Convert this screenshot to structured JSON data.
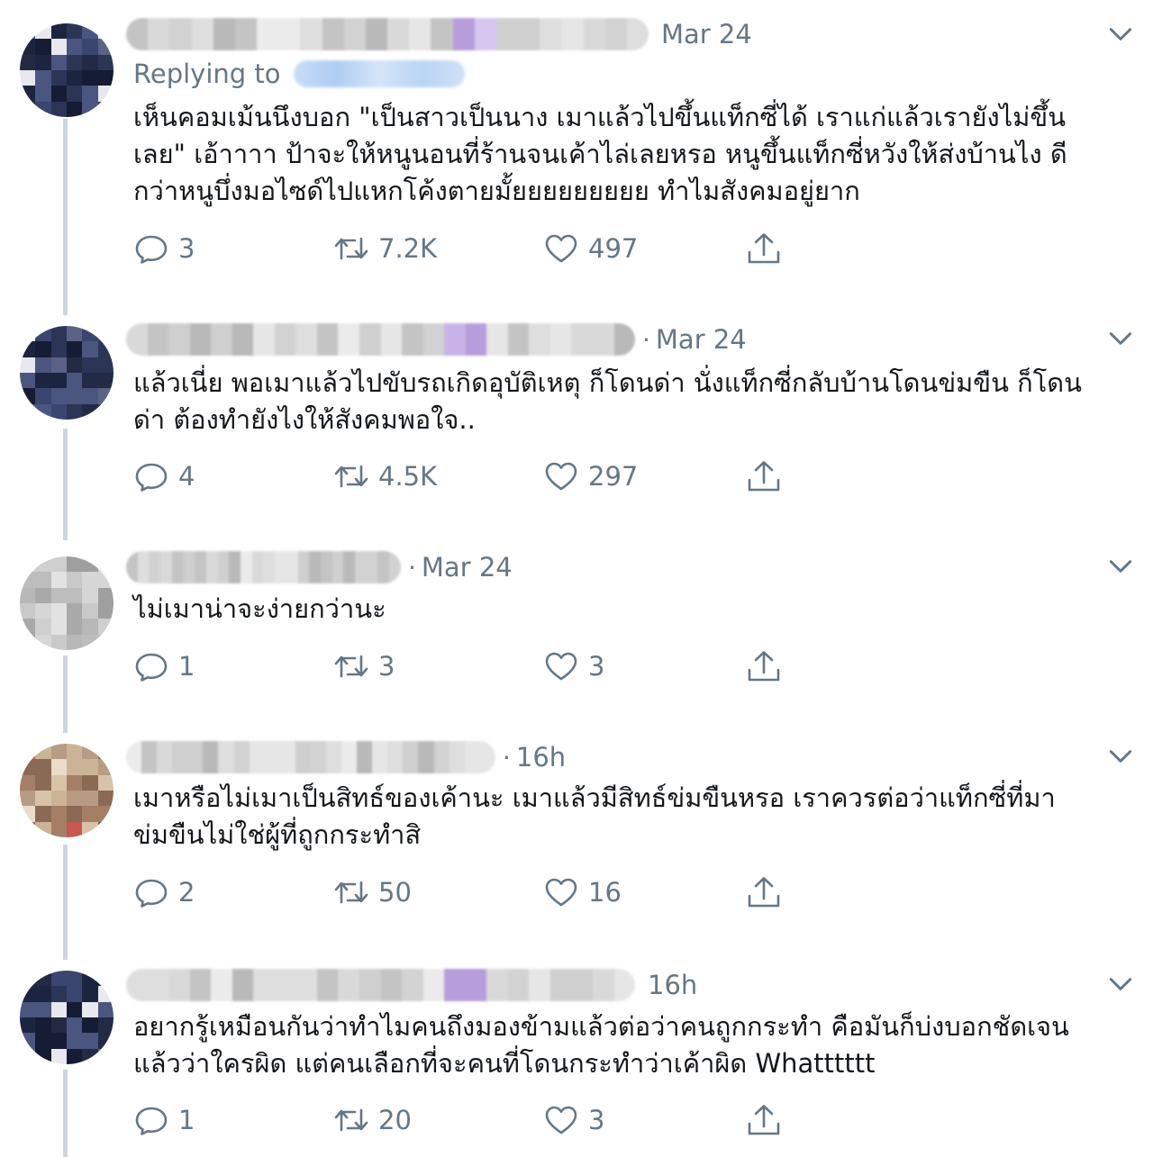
{
  "tweets": [
    {
      "date": "Mar 24",
      "date_prefix": "",
      "replying_label": "Replying to",
      "text_lines": [
        "เห็นคอมเม้นนึงบอก \"เป็นสาวเป็นนาง เมาแล้วไปขึ้นแท็กซี่ได้ เราแก่แล้วเรายังไม่ขึ้น",
        "เลย\" เอ้าาาา ป้าจะให้หนูนอนที่ร้านจนเค้าไล่เลยหรอ หนูขึ้นแท็กซี่หวังให้ส่งบ้านไง ดี",
        "กว่าหนูบึ่งมอไซด์ไปแหกโค้งตายมั้ยยยยยยยยย ทำไมสังคมอยู่ยาก"
      ],
      "replies": "3",
      "retweets": "7.2K",
      "likes": "497"
    },
    {
      "date": "Mar 24",
      "date_prefix": "·",
      "text_lines": [
        "แล้วเนี่ย พอเมาแล้วไปขับรถเกิดอุบัติเหตุ ก็โดนด่า นั่งแท็กซี่กลับบ้านโดนข่มขืน ก็โดน",
        "ด่า ต้องทำยังไงให้สังคมพอใจ.."
      ],
      "replies": "4",
      "retweets": "4.5K",
      "likes": "297"
    },
    {
      "date": "Mar 24",
      "date_prefix": "·",
      "text_lines": [
        "ไม่เมาน่าจะง่ายกว่านะ"
      ],
      "replies": "1",
      "retweets": "3",
      "likes": "3"
    },
    {
      "date": "16h",
      "date_prefix": "·",
      "text_lines": [
        "เมาหรือไม่เมาเป็นสิทธ์ของเค้านะ เมาแล้วมีสิทธ์ข่มขืนหรอ เราควรต่อว่าแท็กซี่ที่มา",
        "ข่มขืนไม่ใช่ผู้ที่ถูกกระทำสิ"
      ],
      "replies": "2",
      "retweets": "50",
      "likes": "16"
    },
    {
      "date": "16h",
      "date_prefix": "",
      "text_lines": [
        "อยากรู้เหมือนกันว่าทำไมคนถึงมองข้ามแล้วต่อว่าคนถูกกระทำ คือมันก็บ่งบอกชัดเจน",
        "แล้วว่าใครผิด แต่คนเลือกที่จะคนที่โดนกระทำว่าเค้าผิด Whatttttt"
      ],
      "replies": "1",
      "retweets": "20",
      "likes": "3"
    }
  ],
  "colors": {
    "text": "#14171a",
    "muted": "#657786",
    "thread_line": "#ccd6dd",
    "mention_blur": "#aecdf3"
  },
  "icons": [
    "reply-icon",
    "retweet-icon",
    "like-icon",
    "share-icon",
    "chevron-down-icon"
  ]
}
